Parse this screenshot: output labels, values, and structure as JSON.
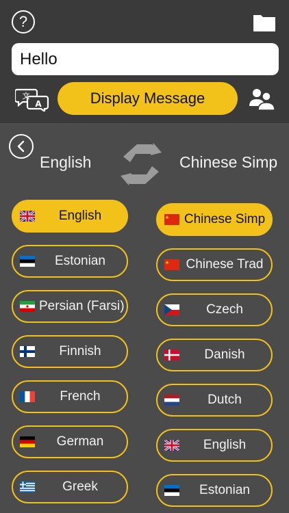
{
  "message": {
    "value": "Hello",
    "placeholder": ""
  },
  "actions": {
    "display_label": "Display Message"
  },
  "languages": {
    "source_heading": "English",
    "target_heading": "Chinese Simp"
  },
  "source_list": [
    {
      "label": "English",
      "flag": "uk-flag",
      "selected": true
    },
    {
      "label": "Estonian",
      "flag": "estonia-flag"
    },
    {
      "label": "Persian (Farsi)",
      "flag": "iran-flag"
    },
    {
      "label": "Finnish",
      "flag": "finland-flag"
    },
    {
      "label": "French",
      "flag": "france-flag"
    },
    {
      "label": "German",
      "flag": "germany-flag"
    },
    {
      "label": "Greek",
      "flag": "greece-flag"
    }
  ],
  "target_list": [
    {
      "label": "Chinese Simp",
      "flag": "china-flag",
      "selected": true
    },
    {
      "label": "Chinese Trad",
      "flag": "china-flag"
    },
    {
      "label": "Czech",
      "flag": "czech-flag"
    },
    {
      "label": "Danish",
      "flag": "denmark-flag"
    },
    {
      "label": "Dutch",
      "flag": "netherlands-flag"
    },
    {
      "label": "English",
      "flag": "uk-flag"
    },
    {
      "label": "Estonian",
      "flag": "estonia-flag"
    }
  ],
  "colors": {
    "accent": "#f2c21b",
    "top_bar": "#3a3a3a",
    "panel": "#4b4b4b"
  },
  "icons": {
    "help": "question-icon",
    "folder": "folder-icon",
    "translate": "translate-icon",
    "group": "group-icon",
    "back": "chevron-left-icon",
    "swap": "swap-icon"
  }
}
